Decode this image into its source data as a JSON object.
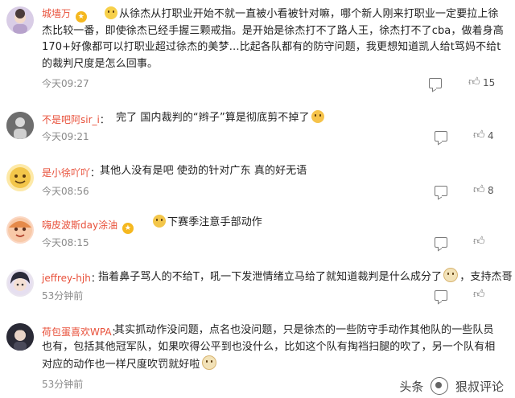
{
  "comments": [
    {
      "user": "城墙万",
      "badge": true,
      "text": "从徐杰从打职业开始不就一直被小看被针对嘛，哪个新人刚来打职业一定要拉上徐杰比较一番，即使徐杰已经手握三颗戒指。是开始是徐杰打不了路人王，徐杰打不了cba，做着身高170+好像都可以打职业超过徐杰的美梦…比起各队都有的防守问题，我更想知道凯人给t骂妈不给t的裁判尺度是怎么回事。",
      "prefix_emoji": true,
      "time": "今天09:27",
      "likes": "15",
      "avatar_color": "#c9b7d8"
    },
    {
      "user": "不是吧阿sir_i",
      "badge": false,
      "text": "完了 国内裁判的“辫子”算是彻底剪不掉了",
      "suffix_emoji": true,
      "time": "今天09:21",
      "likes": "4",
      "avatar_color": "#8a8a8a"
    },
    {
      "user": "是小徐吖吖",
      "badge": false,
      "text": "其他人没有是吧 使劲的针对广东 真的好无语",
      "time": "今天08:56",
      "likes": "8",
      "avatar_color": "#f3c64a"
    },
    {
      "user": "嗨皮波斯day涂油",
      "badge": true,
      "text": "下赛季注意手部动作",
      "prefix_emoji": true,
      "time": "今天08:15",
      "likes": "",
      "avatar_color": "#f4b89a"
    },
    {
      "user": "jeffrey-hjh",
      "badge": false,
      "text": "指着鼻子骂人的不给T，吼一下发泄情绪立马给了就知道裁判是什么成分了",
      "text_tail": "，支持杰哥",
      "suffix_emoji": true,
      "time": "53分钟前",
      "likes": "",
      "avatar_color": "#3a3a4a"
    },
    {
      "user": "荷包蛋喜欢WPA",
      "badge": false,
      "text": "其实抓动作没问题，点名也没问题，只是徐杰的一些防守手动作其他队的一些队员也有，包括其他冠军队，如果吹得公平到也没什么，比如这个队有掏裆扫腿的吹了，另一个队有相对应的动作也一样尺度吹罚就好啦",
      "suffix_emoji": true,
      "time": "53分钟前",
      "likes": "",
      "avatar_color": "#2c2c3a"
    }
  ],
  "footer": {
    "left": "头条",
    "right": "狠叔评论"
  }
}
